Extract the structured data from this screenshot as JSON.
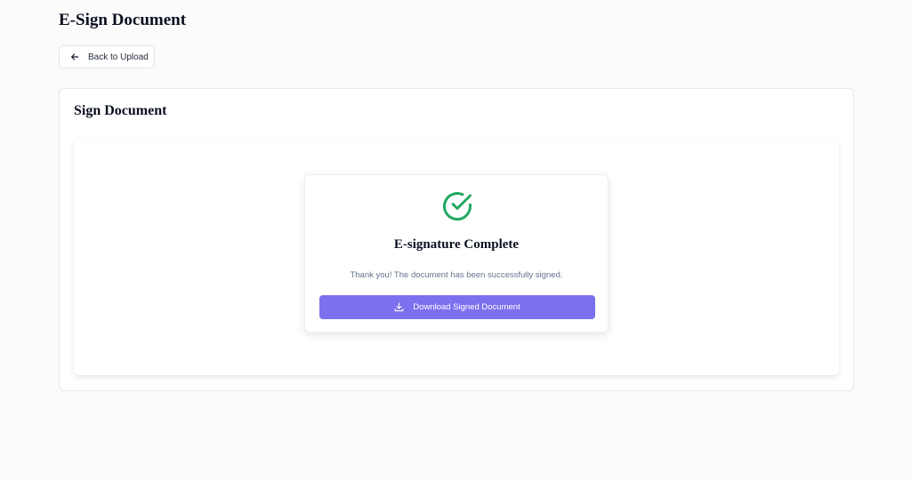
{
  "header": {
    "title": "E-Sign Document"
  },
  "nav": {
    "back_label": "Back to Upload",
    "back_icon": "arrow-left-icon"
  },
  "section": {
    "title": "Sign Document"
  },
  "completion": {
    "icon": "check-circle-icon",
    "title": "E-signature Complete",
    "message": "Thank you! The document has been successfully signed.",
    "download_label": "Download Signed Document",
    "download_icon": "download-icon"
  },
  "colors": {
    "accent": "#7c70ee",
    "success": "#22a861",
    "page_background": "#fbfbfc"
  }
}
